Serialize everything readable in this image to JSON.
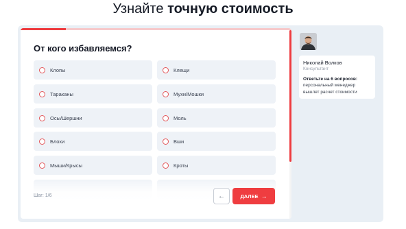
{
  "header": {
    "title_regular": "Узнайте",
    "title_bold": "точную стоимость"
  },
  "quiz": {
    "progress_fraction": 0.167,
    "question": "От кого избавляемся?",
    "options": [
      {
        "label": "Клопы"
      },
      {
        "label": "Клещи"
      },
      {
        "label": "Тараканы"
      },
      {
        "label": "Мухи/Мошки"
      },
      {
        "label": "Осы/Шершни"
      },
      {
        "label": "Моль"
      },
      {
        "label": "Блохи"
      },
      {
        "label": "Вши"
      },
      {
        "label": "Мыши/Крысы"
      },
      {
        "label": "Кроты"
      }
    ],
    "step": "Шаг: 1/6",
    "back_icon": "arrow-left-icon",
    "next_label": "ДАЛЕЕ",
    "next_icon": "arrow-right-icon"
  },
  "manager": {
    "name": "Николай Волков",
    "role": "Консультант",
    "heading": "Ответьте на 6 вопросов:",
    "text": "персональный менеджер вышлет расчет стоимости"
  },
  "colors": {
    "accent": "#ef3d40",
    "panel_bg": "#e9eff5",
    "option_bg": "#eef2f7"
  }
}
